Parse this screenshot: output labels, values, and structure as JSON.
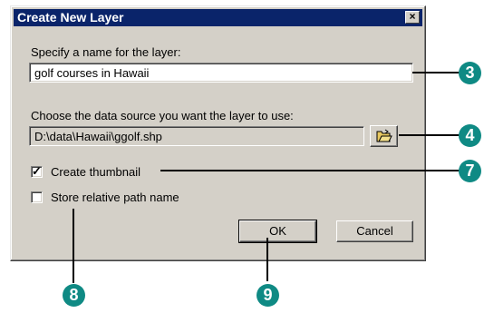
{
  "window": {
    "title": "Create New Layer",
    "close_glyph": "×"
  },
  "name_section": {
    "label": "Specify a name for the layer:",
    "value": "golf courses in Hawaii"
  },
  "source_section": {
    "label": "Choose the data source you want the layer to use:",
    "value": "D:\\data\\Hawaii\\ggolf.shp",
    "browse_icon": "open-folder-icon"
  },
  "options": {
    "create_thumbnail": {
      "label": "Create thumbnail",
      "checked": true,
      "mark": "✓"
    },
    "store_relative_path": {
      "label": "Store relative path name",
      "checked": false
    }
  },
  "buttons": {
    "ok": "OK",
    "cancel": "Cancel"
  },
  "callouts": {
    "name": "3",
    "browse": "4",
    "thumbnail": "7",
    "relative_path": "8",
    "ok": "9",
    "color": "#0f8a84"
  }
}
